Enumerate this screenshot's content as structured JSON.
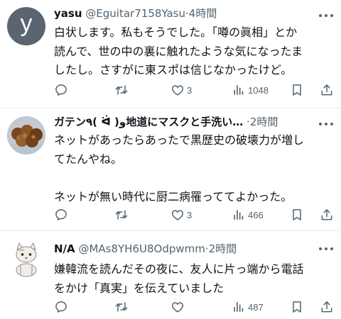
{
  "tweets": [
    {
      "avatar_letter": "y",
      "name": "yasu",
      "handle": "@Eguitar7158Yasu",
      "sep": "·",
      "time": "4時間",
      "lines": [
        "白状します。私もそうでした。「噂の眞相」とか",
        "読んで、世の中の裏に触れたような気になったま",
        "したし。さすがに東スポは信じなかったけど。"
      ],
      "likes": "3",
      "views": "1048"
    },
    {
      "name": "ガテン٩( ᐛ )و地道にマスクと手洗い…",
      "sep": "·",
      "time": "2時間",
      "lines": [
        "ネットがあったらあったで黒歴史の破壊力が増し",
        "てたんやね。",
        "",
        "ネットが無い時代に厨二病罹っててよかった。"
      ],
      "likes": "3",
      "views": "466"
    },
    {
      "name": "N/A",
      "handle": "@MAs8YH6U8Odpwmm",
      "sep": "·",
      "time": "2時間",
      "lines": [
        "嫌韓流を読んだその夜に、友人に片っ端から電話",
        "をかけ「真実」を伝えていました"
      ],
      "likes": "",
      "views": "487"
    }
  ],
  "colors": {
    "text": "#0f1419",
    "muted": "#536471",
    "divider": "#e6e9ec"
  },
  "icons": [
    "reply-icon",
    "retweet-icon",
    "like-icon",
    "views-icon",
    "bookmark-icon",
    "share-icon",
    "more-icon"
  ]
}
